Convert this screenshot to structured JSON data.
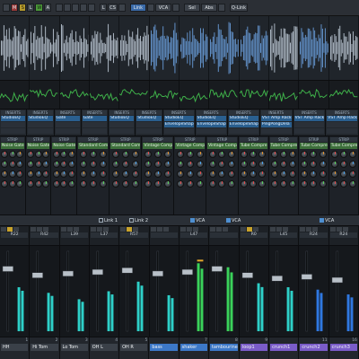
{
  "toolbar": {
    "buttons": [
      {
        "label": "",
        "style": "normal"
      },
      {
        "label": "M",
        "style": "red"
      },
      {
        "label": "S",
        "style": "yellow"
      },
      {
        "label": "L",
        "style": "normal"
      },
      {
        "label": "W",
        "style": "green"
      },
      {
        "label": "A",
        "style": "normal"
      },
      {
        "label": "",
        "style": "normal"
      },
      {
        "label": "",
        "style": "normal"
      },
      {
        "label": "",
        "style": "normal"
      },
      {
        "label": "",
        "style": "normal"
      },
      {
        "label": "",
        "style": "normal"
      },
      {
        "label": "L",
        "style": "normal"
      },
      {
        "label": "CS",
        "style": "normal"
      },
      {
        "label": "",
        "style": "normal"
      },
      {
        "label": "Link",
        "style": "blue"
      },
      {
        "label": "",
        "style": "normal"
      },
      {
        "label": "VCA",
        "style": "normal"
      },
      {
        "label": "",
        "style": "normal"
      },
      {
        "label": "Sel",
        "style": "normal"
      },
      {
        "label": "Abs",
        "style": "normal"
      },
      {
        "label": "",
        "style": "normal"
      },
      {
        "label": "Q-Link",
        "style": "normal"
      }
    ]
  },
  "colors": {
    "wave_blue": "#6fa6e6",
    "wave_white": "#c8d4e0",
    "level_green": "#3fb24a",
    "meter_cyan": "#2ed0c8",
    "meter_green": "#3ad25a",
    "meter_blue": "#2f78e0"
  },
  "waveforms": [
    {
      "color": "wave_white"
    },
    {
      "color": "wave_white"
    },
    {
      "color": "wave_white"
    },
    {
      "color": "wave_white"
    },
    {
      "color": "wave_white"
    },
    {
      "color": "wave_blue"
    },
    {
      "color": "wave_blue"
    },
    {
      "color": "wave_blue"
    },
    {
      "color": "wave_blue"
    },
    {
      "color": "wave_white"
    },
    {
      "color": "wave_blue"
    },
    {
      "color": "wave_white"
    }
  ],
  "inserts": [
    {
      "label": "INSERTS",
      "slots": [
        "StudioEQ",
        "",
        ""
      ]
    },
    {
      "label": "INSERTS",
      "slots": [
        "StudioEQ",
        "",
        ""
      ]
    },
    {
      "label": "INSERTS",
      "slots": [
        "Gate",
        "",
        ""
      ]
    },
    {
      "label": "INSERTS",
      "slots": [
        "Gate",
        "",
        ""
      ]
    },
    {
      "label": "INSERTS",
      "slots": [
        "StudioEQ",
        "",
        ""
      ]
    },
    {
      "label": "INSERTS",
      "slots": [
        "StudioEQ",
        "",
        ""
      ]
    },
    {
      "label": "INSERTS",
      "slots": [
        "StudioEQ",
        "EnvelopeShap",
        ""
      ]
    },
    {
      "label": "INSERTS",
      "slots": [
        "StudioEQ",
        "EnvelopeShap",
        ""
      ]
    },
    {
      "label": "INSERTS",
      "slots": [
        "StudioEQ",
        "EnvelopeShap",
        ""
      ]
    },
    {
      "label": "INSERTS",
      "slots": [
        "VST Amp Rack",
        "PingPongDela",
        ""
      ]
    },
    {
      "label": "INSERTS",
      "slots": [
        "VST Amp Rack",
        "",
        ""
      ]
    },
    {
      "label": "INSERTS",
      "slots": [
        "VST Amp Rack",
        "",
        ""
      ]
    }
  ],
  "strips": [
    {
      "label": "STRIP",
      "module": "Noise Gate",
      "alt": false
    },
    {
      "label": "STRIP",
      "module": "Noise Gate",
      "alt": false
    },
    {
      "label": "STRIP",
      "module": "Noise Gate",
      "alt": false
    },
    {
      "label": "STRIP",
      "module": "Standard Com",
      "alt": false
    },
    {
      "label": "STRIP",
      "module": "Standard Com",
      "alt": false
    },
    {
      "label": "STRIP",
      "module": "Vintage Comp",
      "alt": false
    },
    {
      "label": "STRIP",
      "module": "Vintage Comp",
      "alt": false
    },
    {
      "label": "STRIP",
      "module": "Vintage Comp",
      "alt": false
    },
    {
      "label": "STRIP",
      "module": "Tube Compre",
      "alt": false
    },
    {
      "label": "STRIP",
      "module": "Tube Compre",
      "alt": false
    },
    {
      "label": "STRIP",
      "module": "Tube Compre",
      "alt": false
    },
    {
      "label": "STRIP",
      "module": "Tube Compre",
      "alt": false
    }
  ],
  "links": [
    {
      "text": "Link 1",
      "icon": "link"
    },
    {
      "text": "Link 2",
      "icon": "link"
    },
    {
      "text": "VCA",
      "icon": "vca"
    },
    {
      "text": "VCA",
      "icon": "vca"
    },
    {
      "text": "VCA",
      "icon": "vca"
    }
  ],
  "pans": [
    "R22",
    "R42",
    "L39",
    "L37",
    "R57",
    "",
    "L47",
    "",
    "R0",
    "L45",
    "R24",
    "R24"
  ],
  "faders": [
    {
      "level": 0.78,
      "meter": 0.55,
      "color": "meter_cyan"
    },
    {
      "level": 0.7,
      "meter": 0.48,
      "color": "meter_cyan"
    },
    {
      "level": 0.72,
      "meter": 0.4,
      "color": "meter_cyan"
    },
    {
      "level": 0.74,
      "meter": 0.5,
      "color": "meter_cyan"
    },
    {
      "level": 0.76,
      "meter": 0.62,
      "color": "meter_cyan"
    },
    {
      "level": 0.72,
      "meter": 0.45,
      "color": "meter_cyan"
    },
    {
      "level": 0.74,
      "meter": 0.85,
      "color": "meter_green"
    },
    {
      "level": 0.78,
      "meter": 0.8,
      "color": "meter_green"
    },
    {
      "level": 0.7,
      "meter": 0.6,
      "color": "meter_cyan"
    },
    {
      "level": 0.66,
      "meter": 0.55,
      "color": "meter_cyan"
    },
    {
      "level": 0.68,
      "meter": 0.52,
      "color": "meter_blue"
    },
    {
      "level": 0.64,
      "meter": 0.46,
      "color": "meter_blue"
    }
  ],
  "channels": [
    {
      "num": "1",
      "name": "HH",
      "style": "grey"
    },
    {
      "num": "2",
      "name": "Hi Tom",
      "style": "grey"
    },
    {
      "num": "3",
      "name": "Lo Tom",
      "style": "grey"
    },
    {
      "num": "4",
      "name": "OH L",
      "style": "grey"
    },
    {
      "num": "5",
      "name": "OH R",
      "style": "grey"
    },
    {
      "num": "",
      "name": "bass",
      "style": "blue"
    },
    {
      "num": "7",
      "name": "shaker",
      "style": "blue"
    },
    {
      "num": "8",
      "name": "tambourine",
      "style": "blue"
    },
    {
      "num": "9",
      "name": "loop1",
      "style": "purple"
    },
    {
      "num": "",
      "name": "crunch1",
      "style": "purple"
    },
    {
      "num": "11",
      "name": "crunch2",
      "style": "purple"
    },
    {
      "num": "16",
      "name": "crunch3",
      "style": "purple"
    }
  ]
}
